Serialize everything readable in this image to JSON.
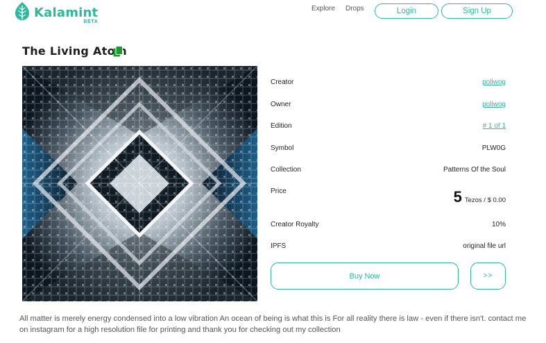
{
  "header": {
    "brand": "Kalamint",
    "brand_badge": "BETA",
    "nav": {
      "explore": "Explore",
      "drops": "Drops"
    },
    "login_label": "Login",
    "signup_label": "Sign Up"
  },
  "token": {
    "title": "The Living Atom",
    "details": {
      "creator_label": "Creator",
      "creator_value": "poliwog",
      "owner_label": "Owner",
      "owner_value": "poliwog",
      "edition_label": "Edition",
      "edition_value": "# 1 of 1",
      "symbol_label": "Symbol",
      "symbol_value": "PLW0G",
      "collection_label": "Collection",
      "collection_value": "Patterns Of the Soul",
      "price_label": "Price",
      "price_amount": "5",
      "price_unit": "Tezos / $ 0.00",
      "royalty_label": "Creator Royalty",
      "royalty_value": "10%",
      "ipfs_label": "IPFS",
      "ipfs_value": "original file url"
    },
    "buy_label": "Buy Now",
    "next_label": ">>",
    "description": "All matter is merely energy condensed into a low vibration An ocean of being is what this is For all reality there is law - even if there isn't. contact me on instagram for a high resolution file for printing and thank you for checking out my collection"
  },
  "colors": {
    "accent": "#2bb99a",
    "text": "#222222",
    "muted": "#555555"
  },
  "icons": {
    "logo": "leaf-logo-icon",
    "copy": "copy-icon"
  }
}
